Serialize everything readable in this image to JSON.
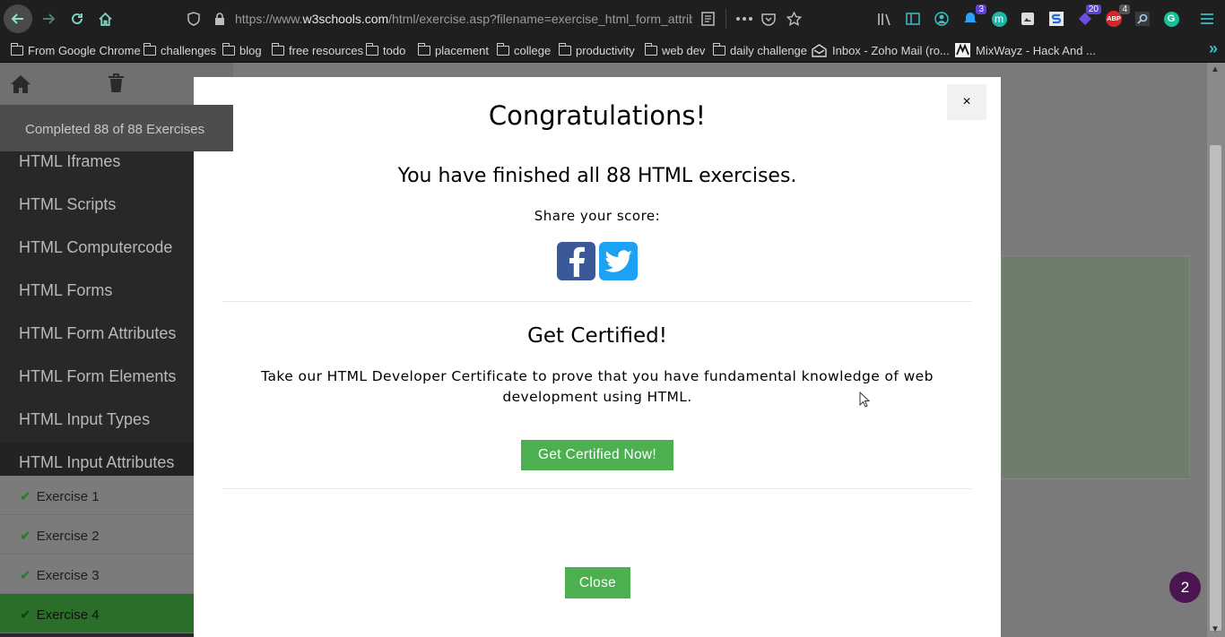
{
  "browser": {
    "url_prefix": "https://www.",
    "url_host": "w3schools.com",
    "url_path": "/html/exercise.asp?filename=exercise_html_form_attribu",
    "badges": {
      "notifications": "3",
      "tabs": "20",
      "abp": "4"
    },
    "abp_label": "ABP"
  },
  "bookmarks": [
    {
      "label": "From Google Chrome",
      "icon": "folder-icon"
    },
    {
      "label": "challenges",
      "icon": "folder-icon"
    },
    {
      "label": "blog",
      "icon": "folder-icon"
    },
    {
      "label": "free resources",
      "icon": "folder-icon"
    },
    {
      "label": "todo",
      "icon": "folder-icon"
    },
    {
      "label": "placement",
      "icon": "folder-icon"
    },
    {
      "label": "college",
      "icon": "folder-icon"
    },
    {
      "label": "productivity",
      "icon": "folder-icon"
    },
    {
      "label": "web dev",
      "icon": "folder-icon"
    },
    {
      "label": "daily challenge",
      "icon": "folder-icon"
    },
    {
      "label": "Inbox - Zoho Mail (ro...",
      "icon": "mail-icon"
    },
    {
      "label": "MixWayz - Hack And ...",
      "icon": "mixwayz-icon"
    }
  ],
  "sidebar": {
    "progress": "Completed 88 of 88 Exercises",
    "topics": [
      "HTML Iframes",
      "HTML Scripts",
      "HTML Computercode",
      "HTML Forms",
      "HTML Form Attributes",
      "HTML Form Elements",
      "HTML Input Types",
      "HTML Input Attributes"
    ],
    "exercises": [
      "Exercise 1",
      "Exercise 2",
      "Exercise 3",
      "Exercise 4"
    ]
  },
  "chat": {
    "count": "2"
  },
  "modal": {
    "close_x": "×",
    "title": "Congratulations!",
    "subtitle": "You have finished all 88 HTML exercises.",
    "share_label": "Share your score:",
    "cert_title": "Get Certified!",
    "cert_text": "Take our HTML Developer Certificate to prove that you have fundamental knowledge of web development using HTML.",
    "cert_button": "Get Certified Now!",
    "close_button": "Close"
  },
  "colors": {
    "accent_green": "#4caf50",
    "facebook": "#3b5998",
    "twitter": "#1da1f2",
    "chat_bubble": "#4a1550"
  }
}
